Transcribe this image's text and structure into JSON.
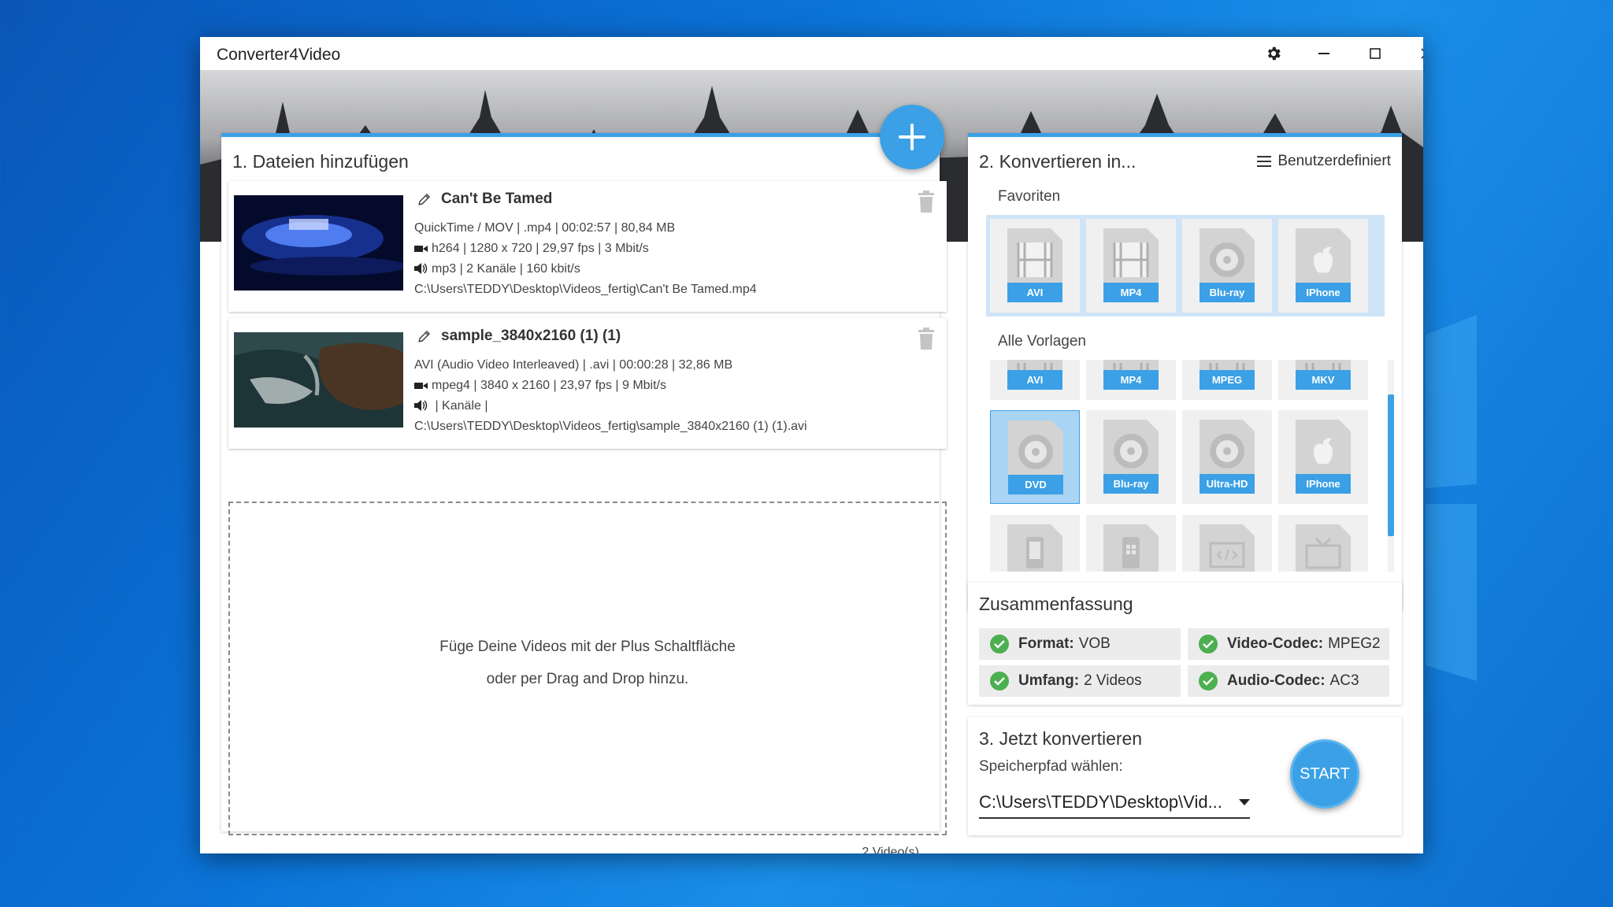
{
  "app": {
    "title": "Converter4Video"
  },
  "files_panel": {
    "title": "1. Dateien hinzufügen",
    "files": [
      {
        "name": "Can't Be Tamed",
        "container": "QuickTime / MOV | .mp4 | 00:02:57 | 80,84 MB",
        "video": "h264 | 1280 x 720 | 29,97 fps | 3 Mbit/s",
        "audio": "mp3 | 2 Kanäle | 160 kbit/s",
        "path": "C:\\Users\\TEDDY\\Desktop\\Videos_fertig\\Can't Be Tamed.mp4"
      },
      {
        "name": "sample_3840x2160 (1) (1)",
        "container": "AVI (Audio Video Interleaved) | .avi | 00:00:28 | 32,86 MB",
        "video": "mpeg4 | 3840 x 2160 | 23,97 fps | 9 Mbit/s",
        "audio": " |  Kanäle | ",
        "path": "C:\\Users\\TEDDY\\Desktop\\Videos_fertig\\sample_3840x2160 (1) (1).avi"
      }
    ],
    "drop_line1": "Füge Deine Videos mit der Plus Schaltfläche",
    "drop_line2": "oder per Drag and Drop hinzu.",
    "count": "2 Video(s)"
  },
  "convert_panel": {
    "title": "2. Konvertieren in...",
    "menu_label": "Benutzerdefiniert",
    "favorites_label": "Favoriten",
    "favorites": [
      {
        "label": "AVI",
        "icon": "film-icon"
      },
      {
        "label": "MP4",
        "icon": "film-icon"
      },
      {
        "label": "Blu-ray",
        "icon": "disc-icon"
      },
      {
        "label": "IPhone",
        "icon": "apple-icon"
      }
    ],
    "templates_label": "Alle Vorlagen",
    "templates": [
      {
        "label": "AVI",
        "icon": "film-icon"
      },
      {
        "label": "MP4",
        "icon": "film-icon"
      },
      {
        "label": "MPEG",
        "icon": "film-icon"
      },
      {
        "label": "MKV",
        "icon": "film-icon"
      },
      {
        "label": "DVD",
        "icon": "disc-icon",
        "selected": true
      },
      {
        "label": "Blu-ray",
        "icon": "disc-icon"
      },
      {
        "label": "Ultra-HD",
        "icon": "disc-icon"
      },
      {
        "label": "IPhone",
        "icon": "apple-icon"
      },
      {
        "label": "",
        "icon": "android-icon"
      },
      {
        "label": "",
        "icon": "windows-phone-icon"
      },
      {
        "label": "",
        "icon": "web-code-icon"
      },
      {
        "label": "",
        "icon": "tv-icon"
      }
    ]
  },
  "summary": {
    "title": "Zusammenfassung",
    "items": [
      {
        "key": "Format:",
        "value": "VOB"
      },
      {
        "key": "Video-Codec:",
        "value": "MPEG2"
      },
      {
        "key": "Umfang:",
        "value": "2 Videos"
      },
      {
        "key": "Audio-Codec:",
        "value": "AC3"
      }
    ]
  },
  "start_panel": {
    "title": "3. Jetzt konvertieren",
    "path_label": "Speicherpfad wählen:",
    "path_value": "C:\\Users\\TEDDY\\Desktop\\Vid...",
    "start_label": "START"
  },
  "colors": {
    "accent": "#3ba0e6",
    "check": "#4caf50",
    "desktop": "#0b74d8"
  }
}
